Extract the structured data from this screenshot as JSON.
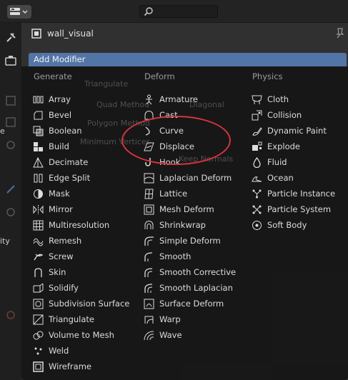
{
  "object": {
    "name": "wall_visual"
  },
  "add_modifier_label": "Add Modifier",
  "columns": {
    "generate": {
      "title": "Generate",
      "items": [
        {
          "label": "Array",
          "icon": "array-icon"
        },
        {
          "label": "Bevel",
          "icon": "bevel-icon"
        },
        {
          "label": "Boolean",
          "icon": "boolean-icon"
        },
        {
          "label": "Build",
          "icon": "build-icon"
        },
        {
          "label": "Decimate",
          "icon": "decimate-icon"
        },
        {
          "label": "Edge Split",
          "icon": "edge-split-icon"
        },
        {
          "label": "Mask",
          "icon": "mask-icon"
        },
        {
          "label": "Mirror",
          "icon": "mirror-icon"
        },
        {
          "label": "Multiresolution",
          "icon": "multires-icon"
        },
        {
          "label": "Remesh",
          "icon": "remesh-icon"
        },
        {
          "label": "Screw",
          "icon": "screw-icon"
        },
        {
          "label": "Skin",
          "icon": "skin-icon"
        },
        {
          "label": "Solidify",
          "icon": "solidify-icon"
        },
        {
          "label": "Subdivision Surface",
          "icon": "subsurf-icon"
        },
        {
          "label": "Triangulate",
          "icon": "triangulate-icon"
        },
        {
          "label": "Volume to Mesh",
          "icon": "volume-icon"
        },
        {
          "label": "Weld",
          "icon": "weld-icon"
        },
        {
          "label": "Wireframe",
          "icon": "wireframe-icon"
        }
      ]
    },
    "deform": {
      "title": "Deform",
      "items": [
        {
          "label": "Armature",
          "icon": "armature-icon"
        },
        {
          "label": "Cast",
          "icon": "cast-icon"
        },
        {
          "label": "Curve",
          "icon": "curve-icon"
        },
        {
          "label": "Displace",
          "icon": "displace-icon"
        },
        {
          "label": "Hook",
          "icon": "hook-icon"
        },
        {
          "label": "Laplacian Deform",
          "icon": "laplacian-icon"
        },
        {
          "label": "Lattice",
          "icon": "lattice-icon"
        },
        {
          "label": "Mesh Deform",
          "icon": "mesh-deform-icon"
        },
        {
          "label": "Shrinkwrap",
          "icon": "shrinkwrap-icon"
        },
        {
          "label": "Simple Deform",
          "icon": "simple-deform-icon"
        },
        {
          "label": "Smooth",
          "icon": "smooth-icon"
        },
        {
          "label": "Smooth Corrective",
          "icon": "smooth-corrective-icon"
        },
        {
          "label": "Smooth Laplacian",
          "icon": "smooth-laplacian-icon"
        },
        {
          "label": "Surface Deform",
          "icon": "surface-deform-icon"
        },
        {
          "label": "Warp",
          "icon": "warp-icon"
        },
        {
          "label": "Wave",
          "icon": "wave-icon"
        }
      ]
    },
    "physics": {
      "title": "Physics",
      "items": [
        {
          "label": "Cloth",
          "icon": "cloth-icon"
        },
        {
          "label": "Collision",
          "icon": "collision-icon"
        },
        {
          "label": "Dynamic Paint",
          "icon": "dynamic-paint-icon"
        },
        {
          "label": "Explode",
          "icon": "explode-icon"
        },
        {
          "label": "Fluid",
          "icon": "fluid-icon"
        },
        {
          "label": "Ocean",
          "icon": "ocean-icon"
        },
        {
          "label": "Particle Instance",
          "icon": "particle-instance-icon"
        },
        {
          "label": "Particle System",
          "icon": "particle-system-icon"
        },
        {
          "label": "Soft Body",
          "icon": "soft-body-icon"
        }
      ]
    }
  },
  "background_ghost": {
    "triangulate": "Triangulate",
    "quad_method": "Quad Method",
    "quad_value": "Diagonal",
    "polygon_method": "Polygon Method",
    "minimum_vertices": "Minimum Vertices",
    "keep_normals": "Keep Normals"
  },
  "left_cutoff": {
    "e": "e",
    "ity": "ity"
  },
  "colors": {
    "accent": "#5274a6",
    "highlight": "#d8343b"
  }
}
